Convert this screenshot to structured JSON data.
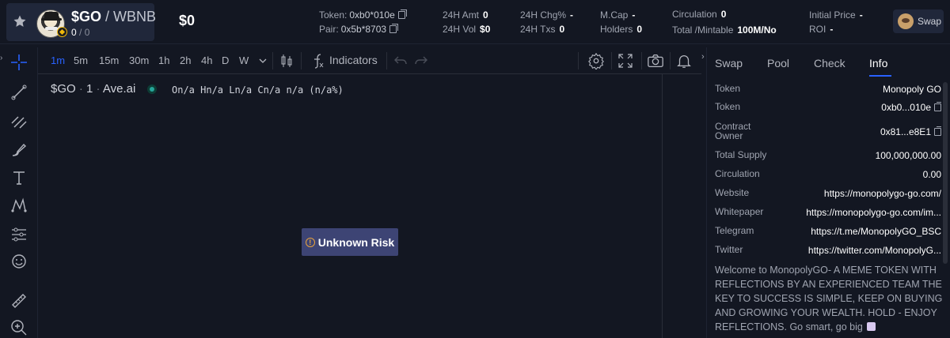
{
  "header": {
    "pair_base": "$GO",
    "pair_quote": "/ WBNB",
    "pair_count_a": "0",
    "pair_count_b": "/ 0",
    "price": "$0",
    "token_label": "Token",
    "token_addr": "0xb0*010e",
    "pair_label": "Pair",
    "pair_addr": "0x5b*8703",
    "amt_label": "24H Amt",
    "amt_value": "0",
    "vol_label": "24H Vol",
    "vol_value": "$0",
    "chg_label": "24H Chg%",
    "chg_value": "-",
    "txs_label": "24H Txs",
    "txs_value": "0",
    "mcap_label": "M.Cap",
    "mcap_value": "-",
    "holders_label": "Holders",
    "holders_value": "0",
    "circ_label": "Circulation",
    "circ_value": "0",
    "mintable_label": "Total /Mintable",
    "mintable_value": "100M/No",
    "initial_label": "Initial Price",
    "initial_value": "-",
    "roi_label": "ROI",
    "roi_value": "-",
    "swap_label": "Swap"
  },
  "toolbar": {
    "timeframes": [
      "1m",
      "5m",
      "15m",
      "30m",
      "1h",
      "2h",
      "4h",
      "D",
      "W"
    ],
    "indicators_label": "Indicators"
  },
  "chart": {
    "symbol": "$GO",
    "interval": "1",
    "source": "Ave.ai",
    "ohlc": "On/a Hn/a Ln/a Cn/a n/a (n/a%)",
    "risk_label": "Unknown Risk"
  },
  "panel": {
    "tabs": [
      "Swap",
      "Pool",
      "Check",
      "Info"
    ],
    "rows": [
      {
        "k": "Token",
        "v": "Monopoly GO"
      },
      {
        "k": "Token",
        "v": "0xb0...010e"
      },
      {
        "k": "Contract Owner",
        "v": "0x81...e8E1"
      },
      {
        "k": "Total Supply",
        "v": "100,000,000.00"
      },
      {
        "k": "Circulation",
        "v": "0.00"
      },
      {
        "k": "Website",
        "v": "https://monopolygo-go.com/"
      },
      {
        "k": "Whitepaper",
        "v": "https://monopolygo-go.com/im..."
      },
      {
        "k": "Telegram",
        "v": "https://t.me/MonopolyGO_BSC"
      },
      {
        "k": "Twitter",
        "v": "https://twitter.com/MonopolyG..."
      }
    ],
    "description": "Welcome to MonopolyGO- A MEME TOKEN WITH REFLECTIONS BY AN EXPERIENCED TEAM THE KEY TO SUCCESS IS SIMPLE, KEEP ON BUYING AND GROWING YOUR WEALTH. HOLD - ENJOY REFLECTIONS. Go smart, go big"
  },
  "colors": {
    "background": "#131722",
    "accent": "#2962ff",
    "risk_button": "#3d4474",
    "live_dot": "#26a69a"
  }
}
